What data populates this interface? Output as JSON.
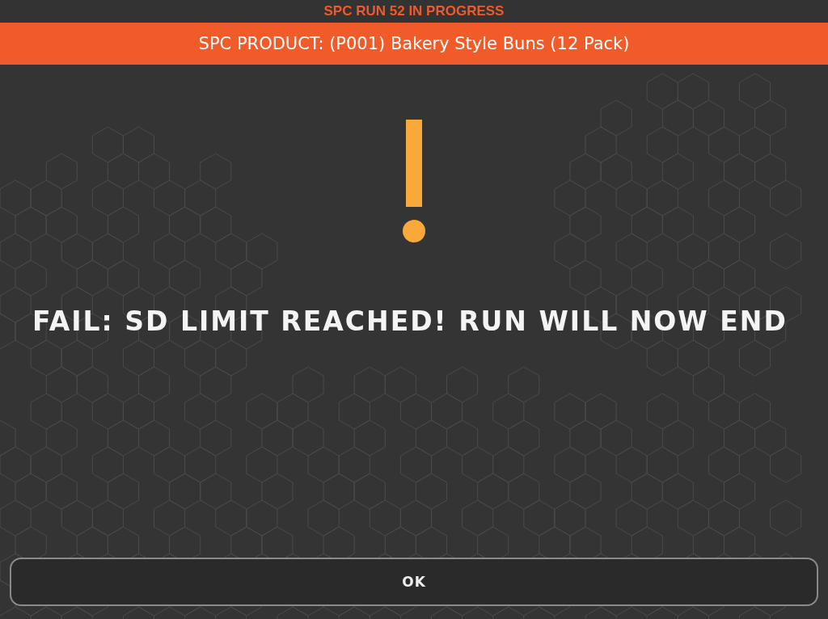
{
  "status_bar": {
    "text": "SPC RUN 52 IN PROGRESS"
  },
  "product_bar": {
    "text": "SPC PRODUCT: (P001) Bakery Style Buns (12 Pack)"
  },
  "alert": {
    "kind": "warning",
    "message": "FAIL: SD LIMIT REACHED! RUN WILL NOW END"
  },
  "buttons": [
    "OK"
  ]
}
